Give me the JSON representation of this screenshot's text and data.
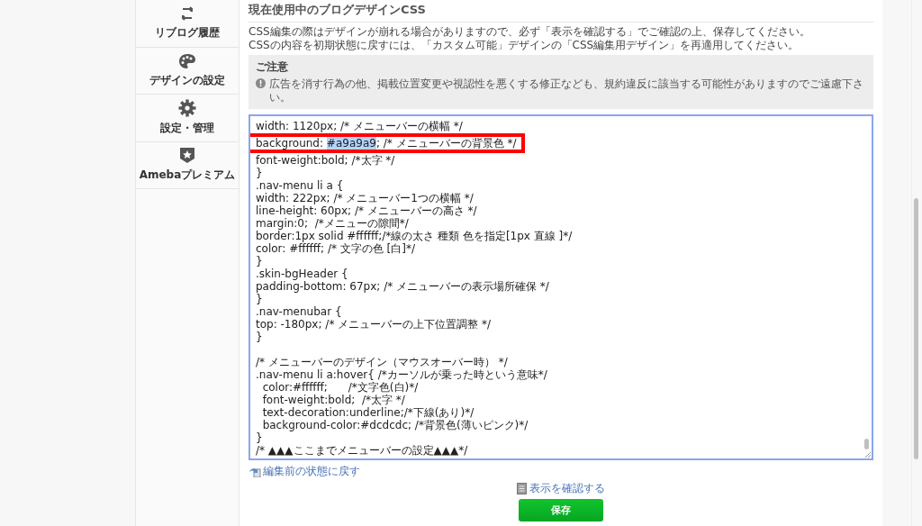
{
  "sidebar": {
    "items": [
      {
        "label": "リブログ履歴"
      },
      {
        "label": "デザインの設定"
      },
      {
        "label": "設定・管理"
      },
      {
        "label": "Amebaプレミアム"
      }
    ]
  },
  "section": {
    "title": "現在使用中のブログデザインCSS",
    "notes": [
      "CSS編集の際はデザインが崩れる場合がありますので、必ず「表示を確認する」でご確認の上、保存してください。",
      "CSSの内容を初期状態に戻すには、「カスタム可能」デザインの「CSS編集用デザイン」を再適用してください。"
    ],
    "caution": {
      "title": "ご注意",
      "text": "広告を消す行為の他、掲載位置変更や視認性を悪くする修正なども、規約違反に該当する可能性がありますのでご遠慮下さい。"
    }
  },
  "editor": {
    "lines": [
      {
        "parts": [
          {
            "text": "width: 1120px; /* メニューバーの横幅 */",
            "selected": false
          }
        ],
        "highlighted": false
      },
      {
        "parts": [
          {
            "text": "background: ",
            "selected": false
          },
          {
            "text": "#a9a9a9",
            "selected": true
          },
          {
            "text": "; /* メニューバーの背景色 */",
            "selected": false
          }
        ],
        "highlighted": true
      },
      {
        "parts": [
          {
            "text": "font-weight:bold; /*太字 */",
            "selected": false
          }
        ],
        "highlighted": false
      },
      {
        "parts": [
          {
            "text": "}",
            "selected": false
          }
        ],
        "highlighted": false
      },
      {
        "parts": [
          {
            "text": ".nav-menu li a {",
            "selected": false
          }
        ],
        "highlighted": false
      },
      {
        "parts": [
          {
            "text": "width: 222px; /* メニューバー1つの横幅 */",
            "selected": false
          }
        ],
        "highlighted": false
      },
      {
        "parts": [
          {
            "text": "line-height: 60px; /* メニューバーの高さ */",
            "selected": false
          }
        ],
        "highlighted": false
      },
      {
        "parts": [
          {
            "text": "margin:0;  /*メニューの隙間*/",
            "selected": false
          }
        ],
        "highlighted": false
      },
      {
        "parts": [
          {
            "text": "border:1px solid #ffffff;/*線の太さ 種類 色を指定[1px 直線 ]*/",
            "selected": false
          }
        ],
        "highlighted": false
      },
      {
        "parts": [
          {
            "text": "color: #ffffff; /* 文字の色 [白]*/",
            "selected": false
          }
        ],
        "highlighted": false
      },
      {
        "parts": [
          {
            "text": "}",
            "selected": false
          }
        ],
        "highlighted": false
      },
      {
        "parts": [
          {
            "text": ".skin-bgHeader {",
            "selected": false
          }
        ],
        "highlighted": false
      },
      {
        "parts": [
          {
            "text": "padding-bottom: 67px; /* メニューバーの表示場所確保 */",
            "selected": false
          }
        ],
        "highlighted": false
      },
      {
        "parts": [
          {
            "text": "}",
            "selected": false
          }
        ],
        "highlighted": false
      },
      {
        "parts": [
          {
            "text": ".nav-menubar {",
            "selected": false
          }
        ],
        "highlighted": false
      },
      {
        "parts": [
          {
            "text": "top: -180px; /* メニューバーの上下位置調整 */",
            "selected": false
          }
        ],
        "highlighted": false
      },
      {
        "parts": [
          {
            "text": "}",
            "selected": false
          }
        ],
        "highlighted": false
      },
      {
        "kind": "blank"
      },
      {
        "parts": [
          {
            "text": "/* メニューバーのデザイン（マウスオーバー時） */",
            "selected": false
          }
        ],
        "highlighted": false
      },
      {
        "parts": [
          {
            "text": ".nav-menu li a:hover{ /*カーソルが乗った時という意味*/",
            "selected": false
          }
        ],
        "highlighted": false
      },
      {
        "parts": [
          {
            "text": "  color:#ffffff;      /*文字色(白)*/",
            "selected": false
          }
        ],
        "highlighted": false
      },
      {
        "parts": [
          {
            "text": "  font-weight:bold;  /*太字 */",
            "selected": false
          }
        ],
        "highlighted": false
      },
      {
        "parts": [
          {
            "text": "  text-decoration:underline;/*下線(あり)*/",
            "selected": false
          }
        ],
        "highlighted": false
      },
      {
        "parts": [
          {
            "text": "  background-color:#dcdcdc; /*背景色(薄いピンク)*/",
            "selected": false
          }
        ],
        "highlighted": false
      },
      {
        "parts": [
          {
            "text": "}",
            "selected": false
          }
        ],
        "highlighted": false
      },
      {
        "parts": [
          {
            "text": "/* ▲▲▲ここまでメニューバーの設定▲▲▲*/",
            "selected": false
          }
        ],
        "highlighted": false
      }
    ]
  },
  "reset_link": "編集前の状態に戻す",
  "preview_link": "表示を確認する",
  "save_button": "保存"
}
